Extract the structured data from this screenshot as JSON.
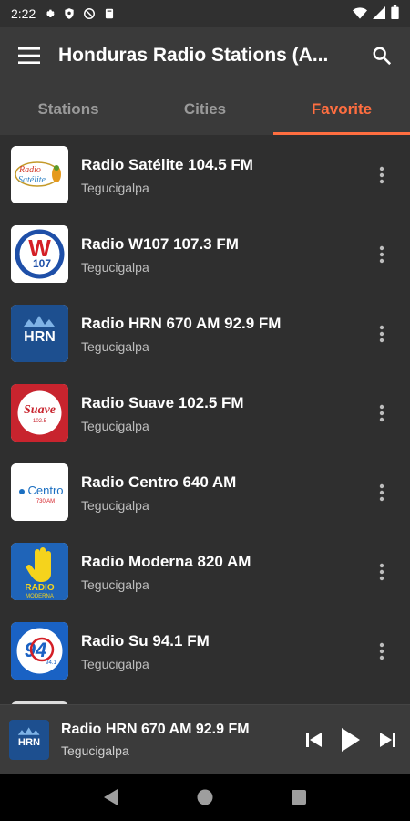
{
  "status_bar": {
    "time": "2:22",
    "left_icons": [
      "gear-icon",
      "shield-icon",
      "no-sync-icon",
      "clipboard-icon"
    ],
    "right_icons": [
      "wifi-icon",
      "signal-icon",
      "battery-icon"
    ]
  },
  "app_bar": {
    "title": "Honduras Radio Stations (A...",
    "menu_icon": "hamburger-menu-icon",
    "search_icon": "search-icon"
  },
  "tabs": [
    {
      "label": "Stations",
      "active": false
    },
    {
      "label": "Cities",
      "active": false
    },
    {
      "label": "Favorite",
      "active": true
    }
  ],
  "colors": {
    "accent": "#ff6e40",
    "background": "#2f2f2f",
    "app_bar": "#3a3a3a",
    "subtext": "#bdbdbd"
  },
  "stations": [
    {
      "name": "Radio Satélite 104.5 FM",
      "city": "Tegucigalpa",
      "logo_text": "Radio Satélite"
    },
    {
      "name": "Radio W107 107.3 FM",
      "city": "Tegucigalpa",
      "logo_text": "W107"
    },
    {
      "name": "Radio HRN 670 AM 92.9 FM",
      "city": "Tegucigalpa",
      "logo_text": "HRN"
    },
    {
      "name": "Radio Suave 102.5 FM",
      "city": "Tegucigalpa",
      "logo_text": "Suave"
    },
    {
      "name": "Radio Centro 640 AM",
      "city": "Tegucigalpa",
      "logo_text": "Centro 730 AM"
    },
    {
      "name": "Radio Moderna 820 AM",
      "city": "Tegucigalpa",
      "logo_text": "RADIO MODERNA"
    },
    {
      "name": "Radio Su 94.1 FM",
      "city": "Tegucigalpa",
      "logo_text": "94.1"
    }
  ],
  "player": {
    "title": "Radio HRN 670 AM 92.9 FM",
    "subtitle": "Tegucigalpa",
    "logo_text": "HRN",
    "controls": [
      "skip-previous-icon",
      "play-icon",
      "skip-next-icon"
    ]
  },
  "nav_bar": {
    "buttons": [
      "back-icon",
      "home-icon",
      "recents-icon"
    ]
  }
}
